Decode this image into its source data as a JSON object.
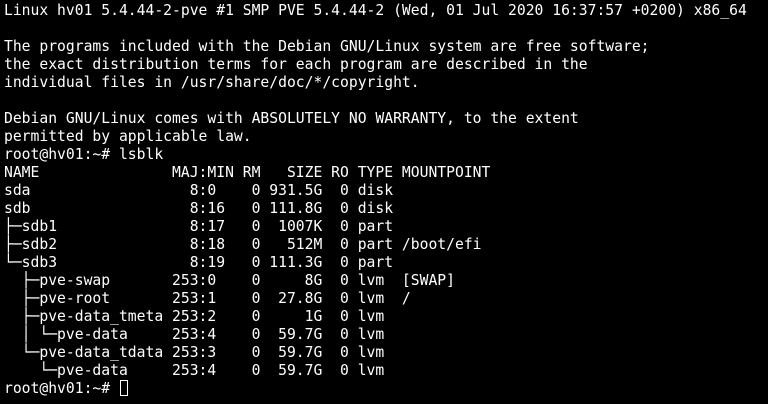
{
  "terminal": {
    "motd": [
      "Linux hv01 5.4.44-2-pve #1 SMP PVE 5.4.44-2 (Wed, 01 Jul 2020 16:37:57 +0200) x86_64",
      "",
      "The programs included with the Debian GNU/Linux system are free software;",
      "the exact distribution terms for each program are described in the",
      "individual files in /usr/share/doc/*/copyright.",
      "",
      "Debian GNU/Linux comes with ABSOLUTELY NO WARRANTY, to the extent",
      "permitted by applicable law."
    ],
    "command_line": "root@hv01:~# lsblk",
    "lsblk_output": [
      "NAME               MAJ:MIN RM   SIZE RO TYPE MOUNTPOINT",
      "sda                  8:0    0 931.5G  0 disk",
      "sdb                  8:16   0 111.8G  0 disk",
      "├─sdb1               8:17   0  1007K  0 part",
      "├─sdb2               8:18   0   512M  0 part /boot/efi",
      "└─sdb3               8:19   0 111.3G  0 part",
      "  ├─pve-swap       253:0    0     8G  0 lvm  [SWAP]",
      "  ├─pve-root       253:1    0  27.8G  0 lvm  /",
      "  ├─pve-data_tmeta 253:2    0     1G  0 lvm",
      "  │ └─pve-data     253:4    0  59.7G  0 lvm",
      "  └─pve-data_tdata 253:3    0  59.7G  0 lvm",
      "    └─pve-data     253:4    0  59.7G  0 lvm"
    ],
    "final_prompt": "root@hv01:~# "
  },
  "colors": {
    "background": "#000000",
    "foreground": "#ffffff"
  }
}
